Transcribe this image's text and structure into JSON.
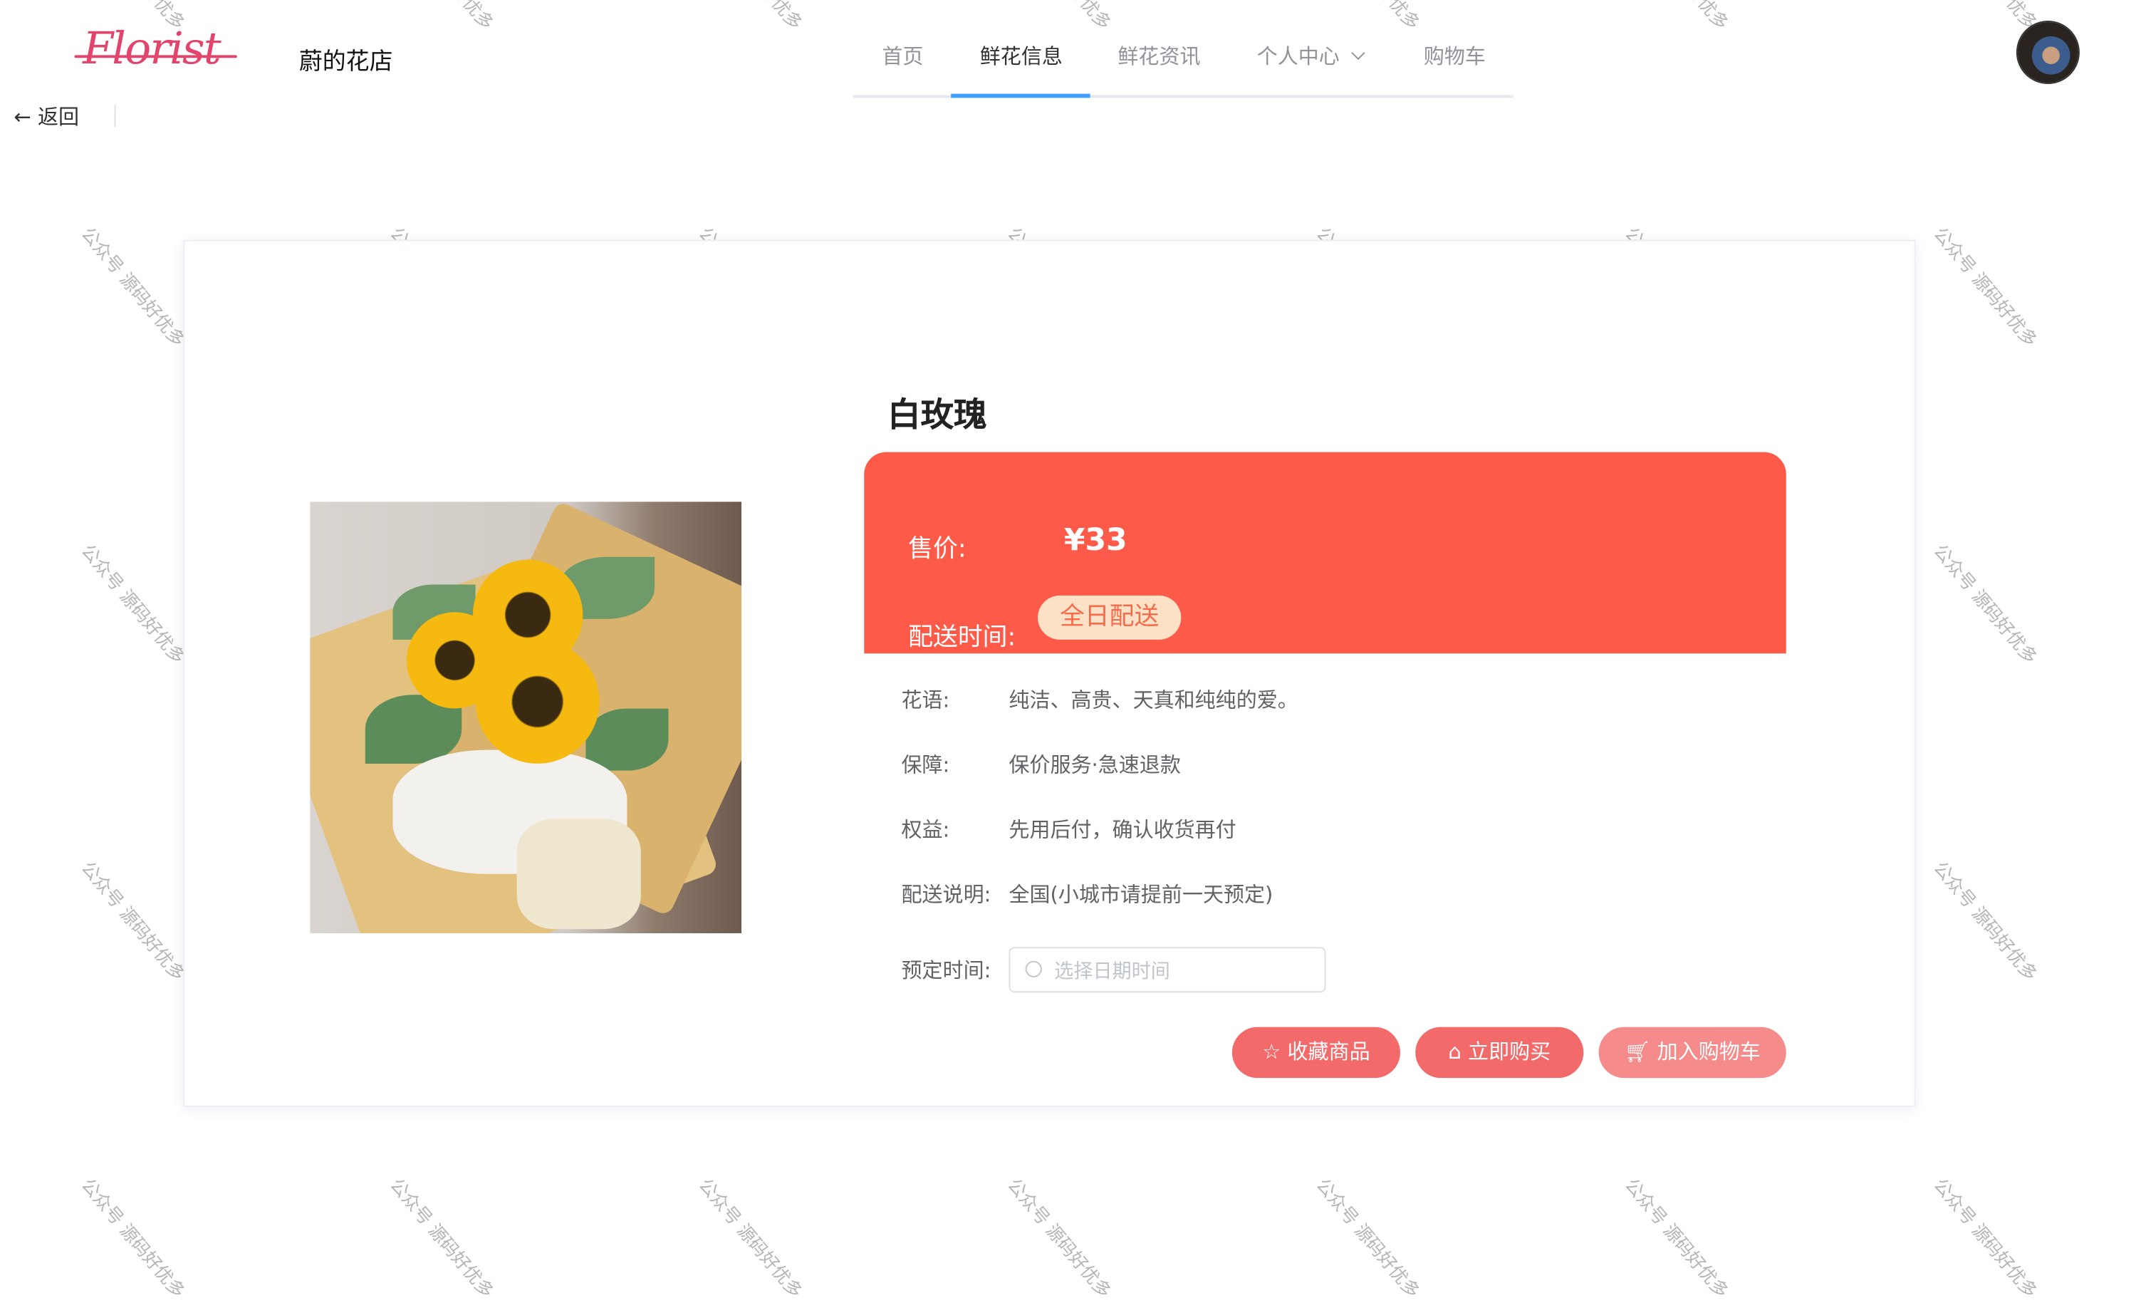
{
  "header": {
    "logo_text": "Florist",
    "shop_name": "蔚的花店",
    "nav": [
      {
        "label": "首页"
      },
      {
        "label": "鲜花信息",
        "active": true
      },
      {
        "label": "鲜花资讯"
      },
      {
        "label": "个人中心",
        "dropdown": true
      },
      {
        "label": "购物车"
      }
    ],
    "accent": "#409eff"
  },
  "back_label": "返回",
  "product": {
    "name": "白玫瑰",
    "price_label": "售价:",
    "price": "¥33",
    "delivery_time_label": "配送时间:",
    "delivery_time": "全日配送",
    "rows": [
      {
        "label": "花语:",
        "value": "纯洁、高贵、天真和纯纯的爱。"
      },
      {
        "label": "保障:",
        "value": "保价服务·急速退款"
      },
      {
        "label": "权益:",
        "value": "先用后付，确认收货再付"
      },
      {
        "label": "配送说明:",
        "value": "全国(小城市请提前一天预定)"
      }
    ],
    "reserve_label": "预定时间:",
    "reserve_placeholder": "选择日期时间",
    "buttons": [
      {
        "label": "收藏商品",
        "icon": "star-icon"
      },
      {
        "label": "立即购买",
        "icon": "bag-icon"
      },
      {
        "label": "加入购物车",
        "icon": "cart-icon"
      }
    ],
    "price_box_color": "#fe5a4a"
  },
  "watermark": "公众号 源码好优多"
}
